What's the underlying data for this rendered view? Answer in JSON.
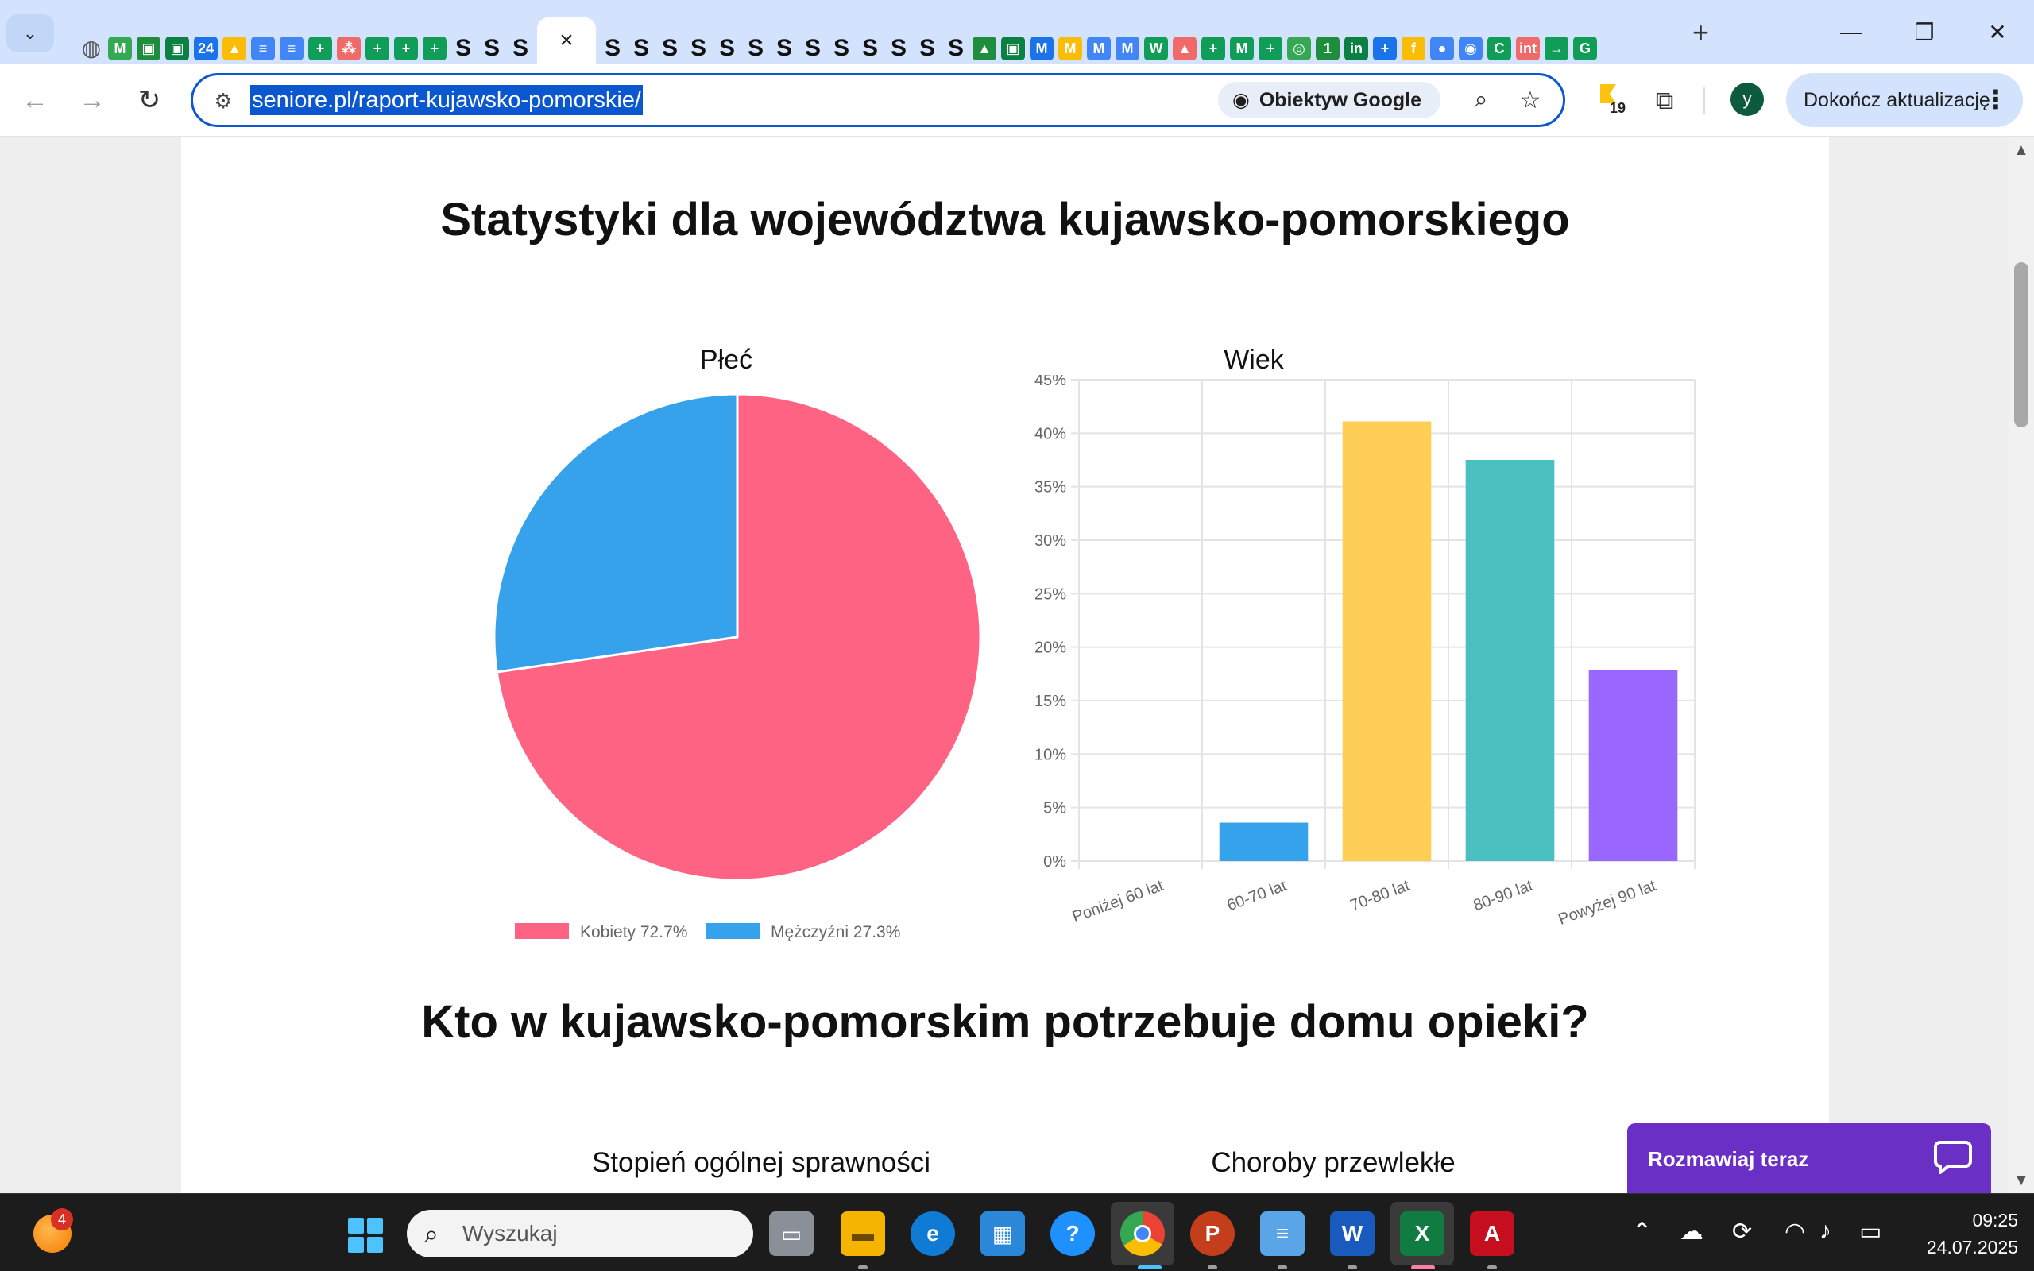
{
  "browser": {
    "active_tab_close": "×",
    "address_url": "seniore.pl/raport-kujawsko-pomorskie/",
    "lens_label": "Obiektyw Google",
    "extension_badge_count": "19",
    "profile_initial": "y",
    "update_button_label": "Dokończ aktualizację",
    "favicons_before": [
      "M",
      "▣",
      "▣",
      "24",
      "▲",
      "≡",
      "≡",
      "+",
      "⁂",
      "+",
      "+",
      "+",
      "S",
      "S",
      "S"
    ],
    "favicons_after": [
      "S",
      "S",
      "S",
      "S",
      "S",
      "S",
      "S",
      "S",
      "S",
      "S",
      "S",
      "S",
      "S",
      "▲",
      "▣",
      "M",
      "M",
      "M",
      "M",
      "W",
      "▲",
      "+",
      "M",
      "+",
      "◎",
      "1",
      "in",
      "+",
      "f",
      "●",
      "◉",
      "C",
      "int",
      "→",
      "G"
    ]
  },
  "page": {
    "heading1": "Statystyki dla województwa kujawsko-pomorskiego",
    "heading2": "Kto w kujawsko-pomorskim potrzebuje domu opieki?",
    "subsection_left": "Stopień ogólnej sprawności",
    "subsection_right": "Choroby przewlekłe"
  },
  "chart_data": [
    {
      "type": "pie",
      "title": "Płeć",
      "slices": [
        {
          "label": "Kobiety 72.7%",
          "value": 72.7,
          "color": "#ff6384"
        },
        {
          "label": "Mężczyźni 27.3%",
          "value": 27.3,
          "color": "#36a2eb"
        }
      ],
      "legend_position": "bottom"
    },
    {
      "type": "bar",
      "title": "Wiek",
      "categories": [
        "Poniżej 60 lat",
        "60-70 lat",
        "70-80 lat",
        "80-90 lat",
        "Powyżej 90 lat"
      ],
      "values": [
        0,
        3.6,
        41.1,
        37.5,
        17.9
      ],
      "colors": [
        "#ff6384",
        "#36a2eb",
        "#ffce56",
        "#4bc0c0",
        "#9966ff"
      ],
      "ylim": [
        0,
        45
      ],
      "yticks": [
        "0%",
        "5%",
        "10%",
        "15%",
        "20%",
        "25%",
        "30%",
        "35%",
        "40%",
        "45%"
      ],
      "grid": true
    }
  ],
  "chat": {
    "label": "Rozmawiaj teraz"
  },
  "taskbar": {
    "search_placeholder": "Wyszukaj",
    "weather_badge": "4",
    "time": "09:25",
    "date": "24.07.2025"
  }
}
